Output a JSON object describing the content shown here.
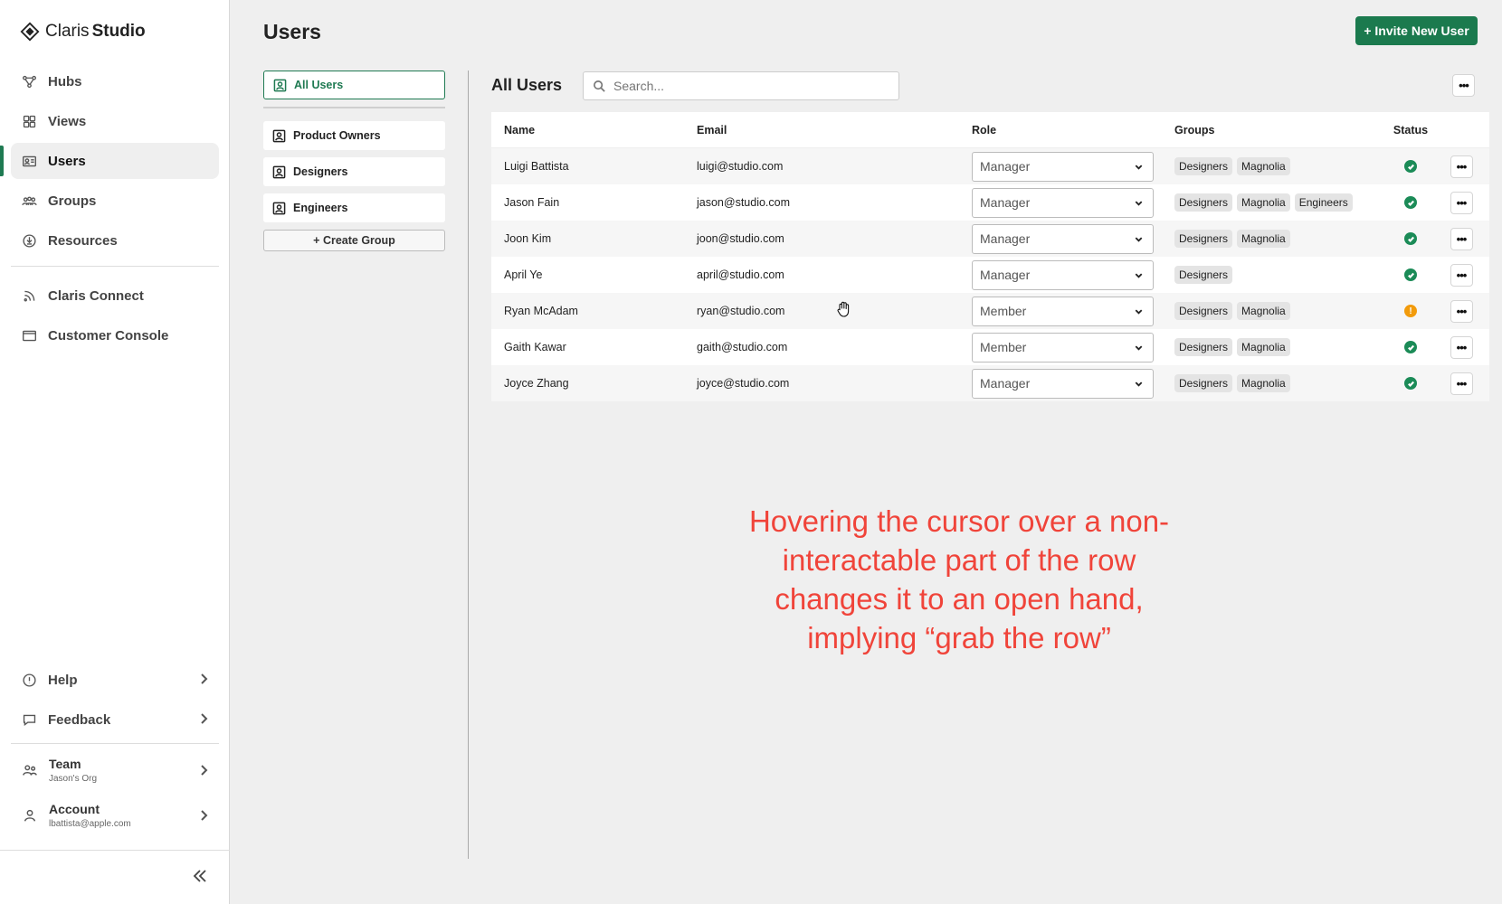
{
  "brand": {
    "name_light": "Claris",
    "name_bold": "Studio"
  },
  "sidebar": {
    "items": [
      {
        "label": "Hubs",
        "icon": "hubs-icon"
      },
      {
        "label": "Views",
        "icon": "views-icon"
      },
      {
        "label": "Users",
        "icon": "users-card-icon",
        "active": true
      },
      {
        "label": "Groups",
        "icon": "groups-icon"
      },
      {
        "label": "Resources",
        "icon": "resources-icon"
      }
    ],
    "secondary": [
      {
        "label": "Claris Connect",
        "icon": "connect-icon"
      },
      {
        "label": "Customer Console",
        "icon": "console-icon"
      }
    ],
    "bottom": [
      {
        "label": "Help",
        "icon": "help-icon"
      },
      {
        "label": "Feedback",
        "icon": "feedback-icon"
      }
    ],
    "team": {
      "label": "Team",
      "sub": "Jason's Org"
    },
    "account": {
      "label": "Account",
      "sub": "lbattista@apple.com"
    }
  },
  "page": {
    "title": "Users",
    "invite_label": "+ Invite New User"
  },
  "groups_panel": {
    "all_users": "All Users",
    "groups": [
      "Product Owners",
      "Designers",
      "Engineers"
    ],
    "create_label": "+ Create Group"
  },
  "table": {
    "title": "All Users",
    "search_placeholder": "Search...",
    "columns": [
      "Name",
      "Email",
      "Role",
      "Groups",
      "Status"
    ],
    "rows": [
      {
        "name": "Luigi Battista",
        "email": "luigi@studio.com",
        "role": "Manager",
        "groups": [
          "Designers",
          "Magnolia"
        ],
        "status": "ok"
      },
      {
        "name": "Jason Fain",
        "email": "jason@studio.com",
        "role": "Manager",
        "groups": [
          "Designers",
          "Magnolia",
          "Engineers"
        ],
        "status": "ok"
      },
      {
        "name": "Joon Kim",
        "email": "joon@studio.com",
        "role": "Manager",
        "groups": [
          "Designers",
          "Magnolia"
        ],
        "status": "ok"
      },
      {
        "name": "April Ye",
        "email": "april@studio.com",
        "role": "Manager",
        "groups": [
          "Designers"
        ],
        "status": "ok"
      },
      {
        "name": "Ryan McAdam",
        "email": "ryan@studio.com",
        "role": "Member",
        "groups": [
          "Designers",
          "Magnolia"
        ],
        "status": "warning"
      },
      {
        "name": "Gaith Kawar",
        "email": "gaith@studio.com",
        "role": "Member",
        "groups": [
          "Designers",
          "Magnolia"
        ],
        "status": "ok"
      },
      {
        "name": "Joyce Zhang",
        "email": "joyce@studio.com",
        "role": "Manager",
        "groups": [
          "Designers",
          "Magnolia"
        ],
        "status": "ok"
      }
    ]
  },
  "annotation": "Hovering the cursor over a non-interactable part of the row changes it to an open hand, implying “grab the row”",
  "colors": {
    "accent": "#1b7a4e",
    "status_ok": "#1b8b57",
    "status_warning": "#f29b0b",
    "annotation": "#f0443a"
  }
}
